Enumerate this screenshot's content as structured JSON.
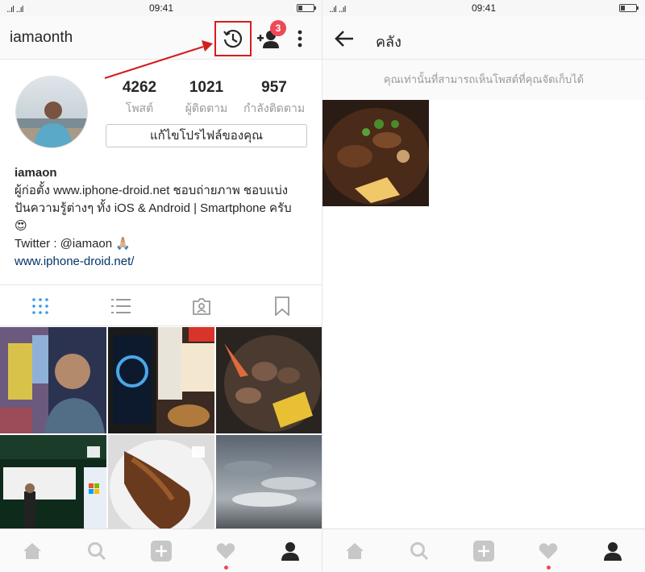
{
  "status_bar": {
    "time": "09:41",
    "signal": "..ıl ..ıl"
  },
  "profile": {
    "username": "iamaonth",
    "notification_count": "3",
    "stats": [
      {
        "value": "4262",
        "label": "โพสต์"
      },
      {
        "value": "1021",
        "label": "ผู้ติดตาม"
      },
      {
        "value": "957",
        "label": "กำลังติดตาม"
      }
    ],
    "edit_button": "แก้ไขโปรไฟล์ของคุณ",
    "bio": {
      "name": "iamaon",
      "line1": "ผู้ก่อตั้ง www.iphone-droid.net ชอบถ่ายภาพ ชอบแบ่ง",
      "line2": "ปันความรู้ต่างๆ ทั้ง iOS & Android | Smartphone ครับ",
      "line3": "😍",
      "twitter": "Twitter : @iamaon 🙏🏼",
      "link": "www.iphone-droid.net/"
    }
  },
  "archive": {
    "title": "คลัง",
    "note": "คุณเท่านั้นที่สามารถเห็นโพสต์ที่คุณจัดเก็บได้"
  },
  "colors": {
    "accent_blue": "#3897f0",
    "badge_red": "#ed4956",
    "highlight_red": "#d41e1e",
    "link_blue": "#003569"
  },
  "icons": {
    "header": [
      "history-icon",
      "add-user-icon",
      "more-vertical-icon"
    ],
    "view_tabs": [
      "grid-view-icon",
      "list-view-icon",
      "tagged-icon",
      "saved-icon"
    ],
    "bottom_nav": [
      "home-icon",
      "search-icon",
      "add-post-icon",
      "activity-heart-icon",
      "profile-icon"
    ]
  }
}
